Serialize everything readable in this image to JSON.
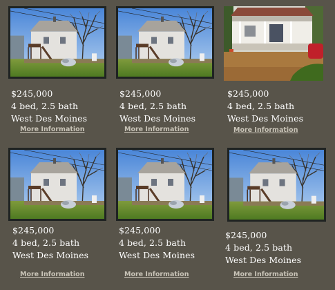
{
  "listings": [
    {
      "price": "$245,000",
      "beds": "4 bed, 2.5 bath",
      "city": "West Des Moines",
      "link": "More Information",
      "photo": "house-photo-back"
    },
    {
      "price": "$245,000",
      "beds": "4 bed, 2.5 bath",
      "city": "West Des Moines",
      "link": "More Information",
      "photo": "house-photo-back"
    },
    {
      "price": "$245,000",
      "beds": "4 bed, 2.5 bath",
      "city": "West Des Moines",
      "link": "More Information",
      "photo": "house-photo-porch"
    },
    {
      "price": "$245,000",
      "beds": "4 bed, 2.5 bath",
      "city": "West Des Moines",
      "link": "More Information",
      "photo": "house-photo-back"
    },
    {
      "price": "$245,000",
      "beds": "4 bed, 2.5 bath",
      "city": "West Des Moines",
      "link": "More Information",
      "photo": "house-photo-back"
    },
    {
      "price": "$245,000",
      "beds": "4 bed, 2.5 bath",
      "city": "West Des Moines",
      "link": "More Information",
      "photo": "house-photo-back"
    }
  ]
}
